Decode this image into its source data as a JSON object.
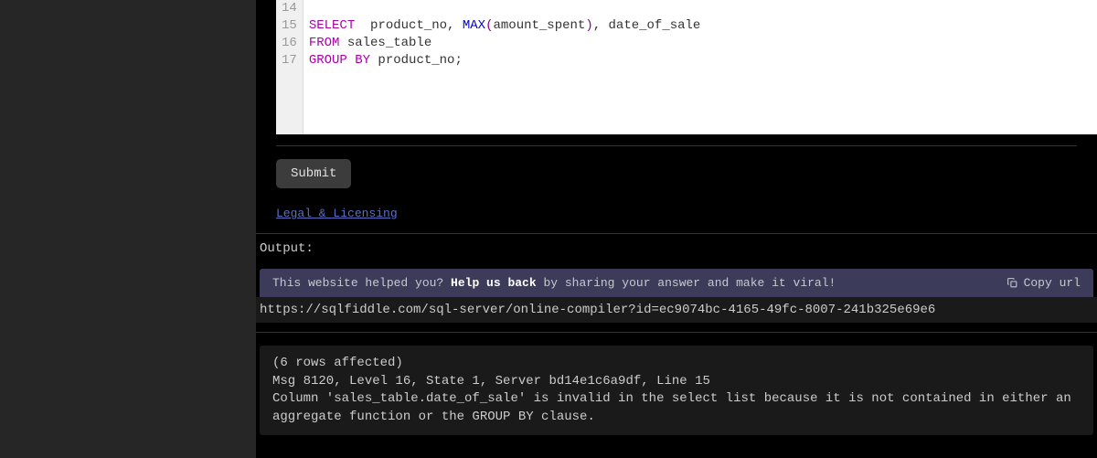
{
  "editor": {
    "line_numbers": [
      "14",
      "15",
      "16",
      "17"
    ],
    "lines": [
      {
        "tokens": []
      },
      {
        "tokens": [
          {
            "t": "SELECT",
            "c": "kw"
          },
          {
            "t": "  product_no, ",
            "c": ""
          },
          {
            "t": "MAX",
            "c": "fn"
          },
          {
            "t": "(",
            "c": "paren"
          },
          {
            "t": "amount_spent",
            "c": ""
          },
          {
            "t": ")",
            "c": "paren"
          },
          {
            "t": ", date_of_sale",
            "c": ""
          }
        ]
      },
      {
        "tokens": [
          {
            "t": "FROM",
            "c": "kw"
          },
          {
            "t": " sales_table",
            "c": ""
          }
        ]
      },
      {
        "tokens": [
          {
            "t": "GROUP BY",
            "c": "kw"
          },
          {
            "t": " product_no;",
            "c": ""
          }
        ]
      }
    ]
  },
  "buttons": {
    "submit_label": "Submit"
  },
  "links": {
    "legal": "Legal & Licensing"
  },
  "output": {
    "label": "Output:",
    "help_before": "This website helped you? ",
    "help_strong": "Help us back",
    "help_after": " by sharing your answer and make it viral!",
    "copy_label": "Copy url",
    "url": "https://sqlfiddle.com/sql-server/online-compiler?id=ec9074bc-4165-49fc-8007-241b325e69e6",
    "error_lines": [
      "(6 rows affected)",
      "Msg 8120, Level 16, State 1, Server bd14e1c6a9df, Line 15",
      "Column 'sales_table.date_of_sale' is invalid in the select list because it is not contained in either an aggregate function or the GROUP BY clause."
    ]
  }
}
